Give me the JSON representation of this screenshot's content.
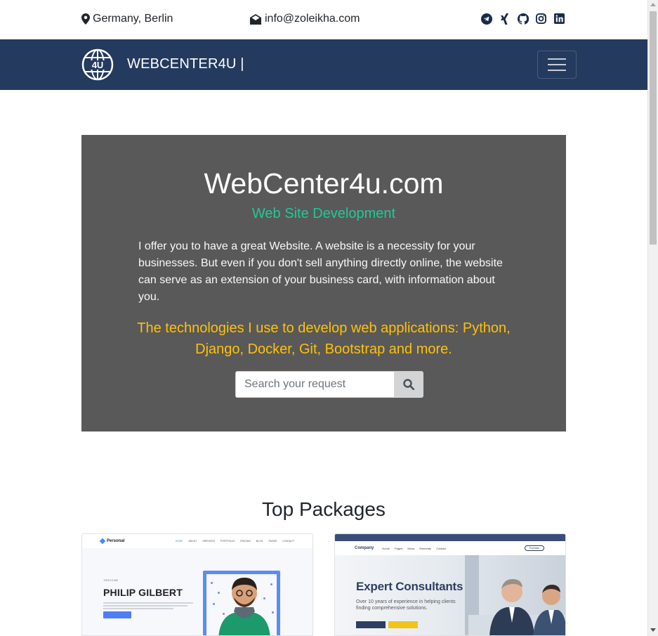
{
  "topbar": {
    "location": "Germany, Berlin",
    "email": "info@zoleikha.com",
    "social_icons": [
      "telegram-icon",
      "xing-icon",
      "github-icon",
      "instagram-icon",
      "linkedin-icon"
    ]
  },
  "navbar": {
    "logo_text": "4U",
    "brand": "WEBCENTER4U |",
    "menu_icon": "hamburger-menu-icon"
  },
  "hero": {
    "title": "WebCenter4u.com",
    "subtitle": "Web Site Development",
    "description": "I offer you to have a great Website. A website is a necessity for your businesses. But even if you don't sell anything directly online, the website can serve as an extension of your business card, with information about you.",
    "technologies": "The technologies I use to develop web applications: Python, Django, Docker, Git, Bootstrap and more.",
    "search_placeholder": "Search your request",
    "search_icon": "search-icon"
  },
  "packages": {
    "title": "Top Packages",
    "cards": [
      {
        "brand": "Personal",
        "nav_links": [
          "HOME",
          "ABOUT",
          "SERVICES",
          "PORTFOLIO",
          "PRICING",
          "BLOG",
          "PAGES",
          "CONTACT"
        ],
        "tagline": "THIS IS ME",
        "heading": "PHILIP GILBERT"
      },
      {
        "brand": "Company",
        "nav_links": [
          "Home",
          "Pages",
          "News",
          "Elements",
          "Contact"
        ],
        "nav_button": "Purchase",
        "heading": "Expert Consultants",
        "text": "Over 10 years of experience in helping clients finding comprehensive solutions."
      }
    ]
  },
  "colors": {
    "navbar": "#243a5e",
    "hero_bg": "#595959",
    "subtitle": "#20c997",
    "technologies": "#ffc107"
  }
}
